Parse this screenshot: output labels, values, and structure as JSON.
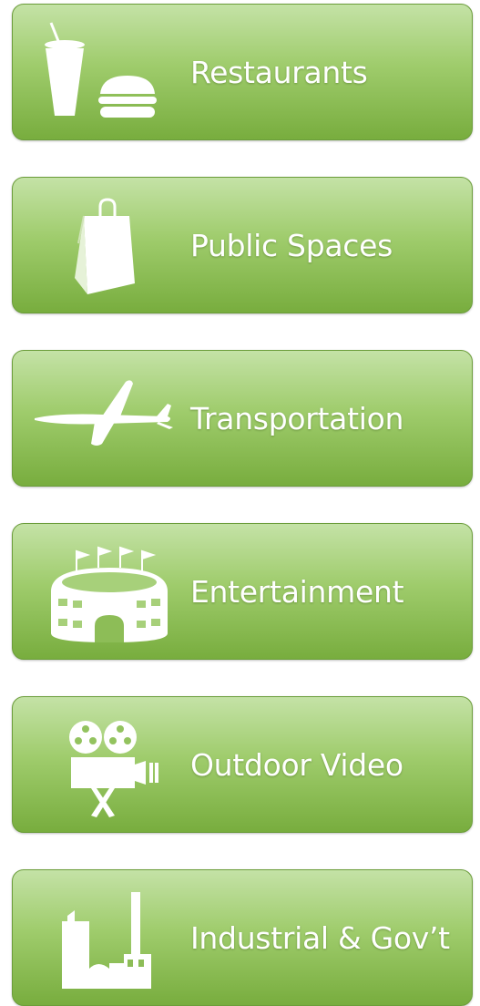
{
  "menu": {
    "items": [
      {
        "label": "Restaurants",
        "icon": "food-drink-icon"
      },
      {
        "label": "Public Spaces",
        "icon": "shopping-bag-icon"
      },
      {
        "label": "Transportation",
        "icon": "airplane-icon"
      },
      {
        "label": "Entertainment",
        "icon": "stadium-icon"
      },
      {
        "label": "Outdoor Video",
        "icon": "film-camera-icon"
      },
      {
        "label": "Industrial & Gov’t",
        "icon": "factory-icon"
      }
    ]
  },
  "colors": {
    "tile_top": "#c4e2a6",
    "tile_bottom": "#78ad3e",
    "tile_border": "#6b9d3a",
    "text": "#ffffff"
  }
}
